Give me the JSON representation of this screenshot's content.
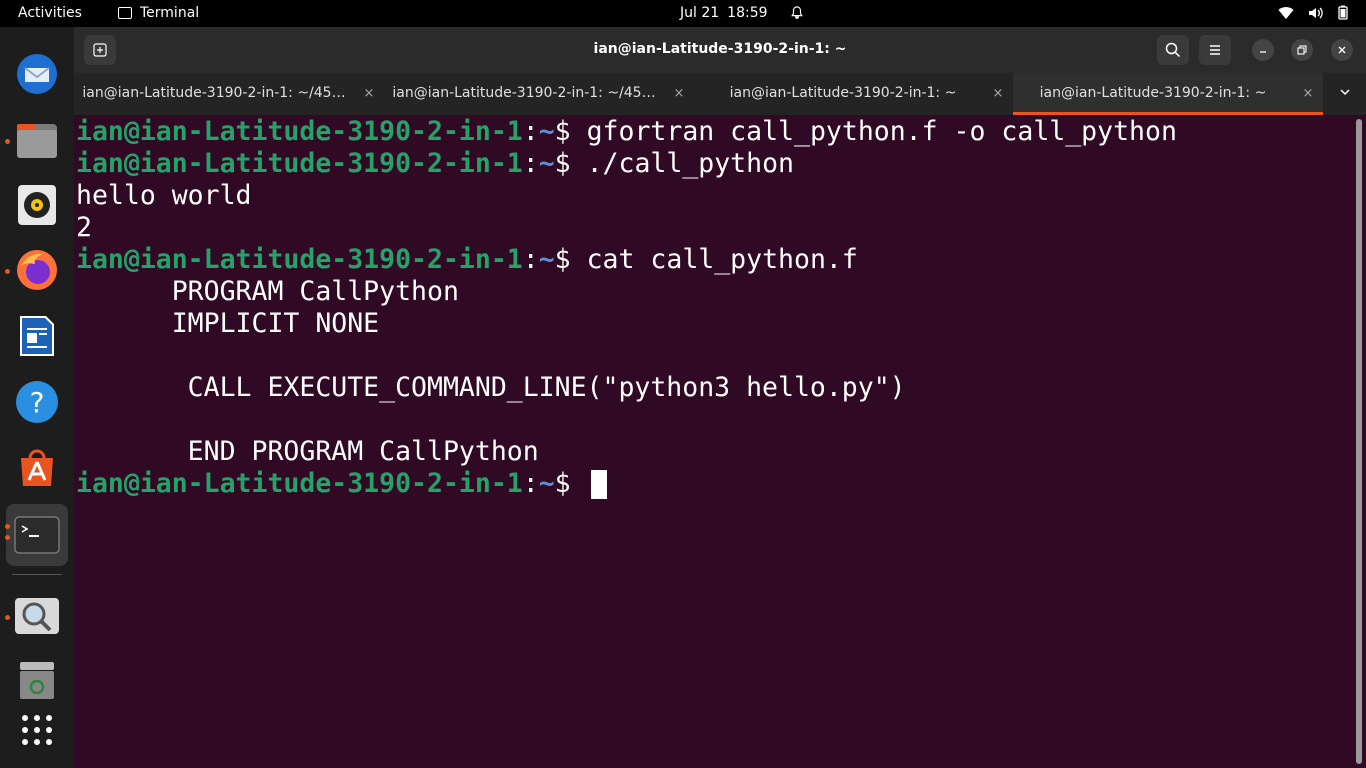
{
  "topbar": {
    "activities": "Activities",
    "app_name": "Terminal",
    "date": "Jul 21",
    "time": "18:59"
  },
  "dock": {
    "items": [
      "thunderbird-icon",
      "files-icon",
      "rhythmbox-icon",
      "firefox-icon",
      "libreoffice-writer-icon",
      "help-icon",
      "app-center-icon",
      "terminal-icon",
      "disk-usage-icon",
      "trash-icon",
      "show-apps-icon"
    ]
  },
  "window": {
    "title": "ian@ian-Latitude-3190-2-in-1: ~",
    "tabs": [
      {
        "label": "ian@ian-Latitude-3190-2-in-1: ~/45…"
      },
      {
        "label": "ian@ian-Latitude-3190-2-in-1: ~/45…"
      },
      {
        "label": "ian@ian-Latitude-3190-2-in-1: ~"
      },
      {
        "label": "ian@ian-Latitude-3190-2-in-1: ~"
      }
    ],
    "close_glyph": "×"
  },
  "terminal": {
    "prompt_user": "ian@ian-Latitude-3190-2-in-1",
    "prompt_path": "~",
    "lines": [
      {
        "type": "prompt",
        "cmd": "gfortran call_python.f -o call_python"
      },
      {
        "type": "prompt",
        "cmd": "./call_python"
      },
      {
        "type": "out",
        "text": "hello world"
      },
      {
        "type": "out",
        "text": "2"
      },
      {
        "type": "prompt",
        "cmd": "cat call_python.f"
      },
      {
        "type": "out",
        "text": "      PROGRAM CallPython"
      },
      {
        "type": "out",
        "text": "      IMPLICIT NONE"
      },
      {
        "type": "out",
        "text": ""
      },
      {
        "type": "out",
        "text": "       CALL EXECUTE_COMMAND_LINE(\"python3 hello.py\")"
      },
      {
        "type": "out",
        "text": ""
      },
      {
        "type": "out",
        "text": "       END PROGRAM CallPython"
      },
      {
        "type": "prompt",
        "cmd": ""
      }
    ]
  },
  "colors": {
    "terminal_bg": "#300a24",
    "prompt_user": "#26a269",
    "accent": "#e95420"
  }
}
